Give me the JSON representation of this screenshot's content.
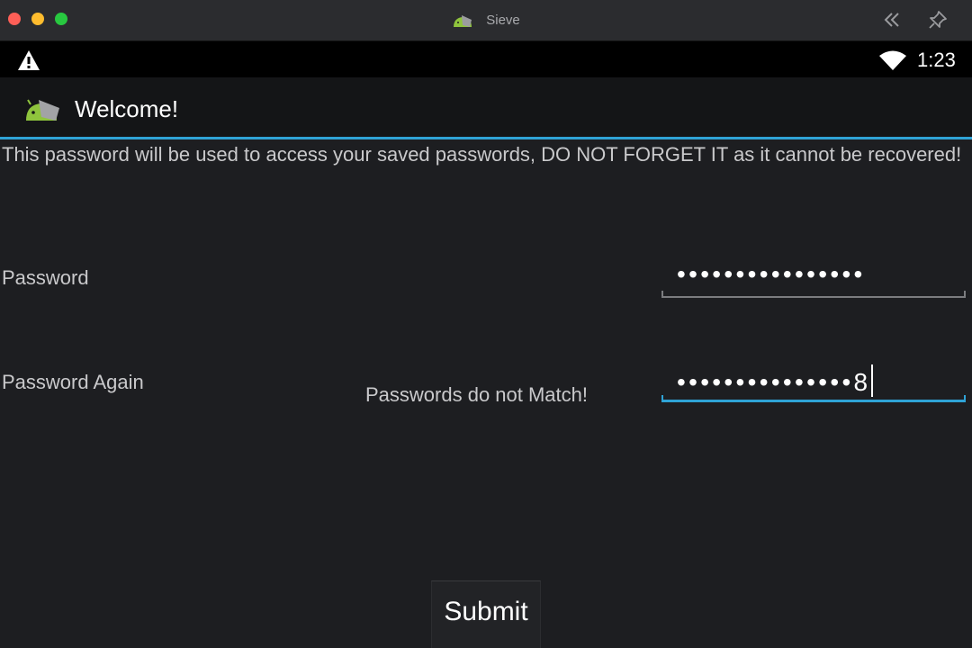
{
  "window": {
    "title": "Sieve"
  },
  "status_bar": {
    "time": "1:23",
    "icons": [
      "warning-icon",
      "wifi-icon"
    ]
  },
  "action_bar": {
    "title": "Welcome!",
    "icon": "android-app-icon"
  },
  "content": {
    "notice": "This password will be used to access your saved passwords, DO NOT FORGET IT as it cannot be recovered!",
    "password_label": "Password",
    "password_value": "••••••••••••••••",
    "password_again_label": "Password Again",
    "password_again_value": "•••••••••••••••",
    "password_again_last_char": "8",
    "mismatch_message": "Passwords do not Match!",
    "submit_label": "Submit"
  },
  "colors": {
    "accent": "#2fa3d6",
    "background": "#1d1e21",
    "statusbar": "#000000"
  }
}
